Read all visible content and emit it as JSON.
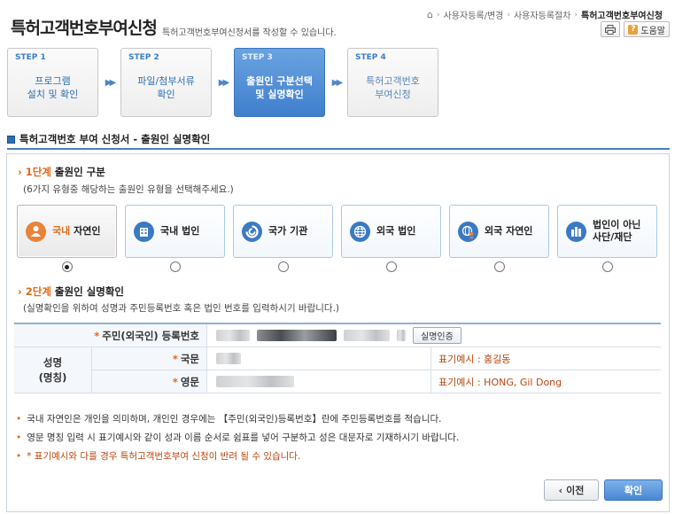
{
  "header": {
    "title": "특허고객번호부여신청",
    "description": "특허고객번호부여신청서를 작성할 수 있습니다.",
    "breadcrumb": [
      "사용자등록/변경",
      "사용자등록절차",
      "특허고객번호부여신청"
    ],
    "print_icon": "print-icon",
    "help_label": "도움말"
  },
  "steps": [
    {
      "num": "STEP 1",
      "label": "프로그램\n설치 및 확인",
      "state": "done"
    },
    {
      "num": "STEP 2",
      "label": "파일/첨부서류\n확인",
      "state": "done"
    },
    {
      "num": "STEP 3",
      "label": "출원인 구분선택\n및 실명확인",
      "state": "active"
    },
    {
      "num": "STEP 4",
      "label": "특허고객번호\n부여신청",
      "state": "pending"
    }
  ],
  "section_title": "특허고객번호 부여 신청서 - 출원인 실명확인",
  "stage1": {
    "stage": "1단계",
    "title": "출원인 구분",
    "subtitle": "(6가지 유형중 해당하는 출원인 유형을 선택해주세요.)",
    "types": [
      {
        "hl": "국내",
        "rest": " 자연인",
        "icon": "person-icon",
        "selected": true
      },
      {
        "hl": "",
        "rest": "국내 법인",
        "icon": "building-icon",
        "selected": false
      },
      {
        "hl": "",
        "rest": "국가 기관",
        "icon": "government-icon",
        "selected": false
      },
      {
        "hl": "",
        "rest": "외국 법인",
        "icon": "globe-icon",
        "selected": false
      },
      {
        "hl": "",
        "rest": "외국 자연인",
        "icon": "globe-person-icon",
        "selected": false
      },
      {
        "hl": "",
        "rest": "법인이 아닌\n사단/재단",
        "icon": "organization-icon",
        "selected": false
      }
    ]
  },
  "stage2": {
    "stage": "2단계",
    "title": "출원인 실명확인",
    "subtitle": "(실명확인을 위하여 성명과 주민등록번호 혹은 법인 번호를 입력하시기 바랍니다.)",
    "rrn_label": "주민(외국인) 등록번호",
    "verify_button": "실명인증",
    "name_label_1": "성명",
    "name_label_2": "(명칭)",
    "korean_label": "국문",
    "korean_example": "표기예시 : 홍길동",
    "english_label": "영문",
    "english_example": "표기예시 : HONG, Gil Dong"
  },
  "notes": [
    "국내 자연인은 개인을 의미하며, 개인인 경우에는 【주민(외국인)등록번호】란에 주민등록번호를 적습니다.",
    "영문 명칭 입력 시 표기예시와 같이 성과 이름 순서로 쉼표를 넣어 구분하고 성은 대문자로 기재하시기 바랍니다.",
    "* 표기예시와 다를 경우 특허고객번호부여 신청이 반려 될 수 있습니다."
  ],
  "buttons": {
    "prev": "이전",
    "ok": "확인"
  }
}
